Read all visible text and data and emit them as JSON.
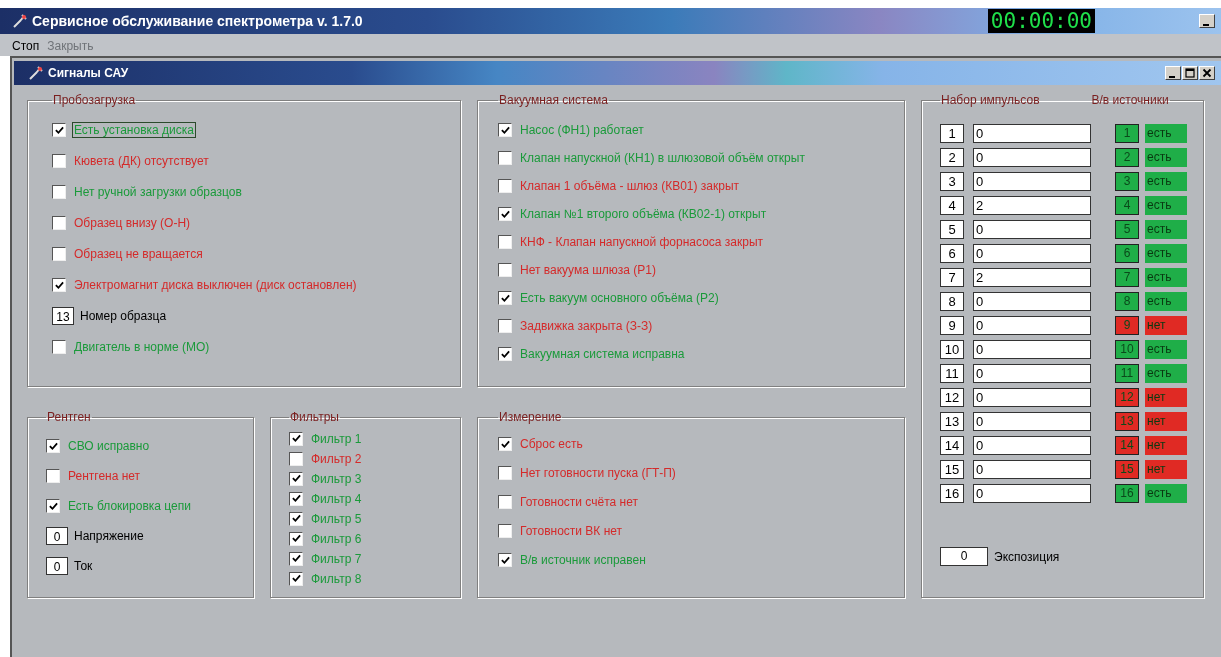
{
  "window": {
    "title": "Сервисное обслуживание спектрометра v. 1.7.0",
    "timer": "00:00:00"
  },
  "menu": [
    {
      "label": "Стоп",
      "disabled": false
    },
    {
      "label": "Закрыть",
      "disabled": true
    }
  ],
  "child_window": {
    "title": "Сигналы САУ"
  },
  "groups": [
    {
      "title": "Пробозагрузка",
      "items": [
        {
          "kind": "checkbox",
          "label": "Есть установка диска",
          "checked": true,
          "color": "#1a9a3a",
          "focused": true
        },
        {
          "kind": "checkbox",
          "label": "Кювета (ДК) отсутствует",
          "checked": false,
          "color": "#d42a2a",
          "focused": false
        },
        {
          "kind": "checkbox",
          "label": "Нет ручной загрузки образцов",
          "checked": false,
          "color": "#1a9a3a",
          "focused": false
        },
        {
          "kind": "checkbox",
          "label": "Образец внизу (О-Н)",
          "checked": false,
          "color": "#d42a2a",
          "focused": false
        },
        {
          "kind": "checkbox",
          "label": "Образец не вращается",
          "checked": false,
          "color": "#d42a2a",
          "focused": false
        },
        {
          "kind": "checkbox",
          "label": "Электромагнит диска выключен (диск остановлен)",
          "checked": true,
          "color": "#d42a2a",
          "focused": false
        },
        {
          "kind": "number",
          "value": "13",
          "label": "Номер образца"
        },
        {
          "kind": "checkbox",
          "label": "Двигатель в норме (МО)",
          "checked": false,
          "color": "#1a9a3a",
          "focused": false
        }
      ]
    },
    {
      "title": "Вакуумная система",
      "items": [
        {
          "kind": "checkbox",
          "label": "Насос (ФН1) работает",
          "checked": true,
          "color": "#1a9a3a"
        },
        {
          "kind": "checkbox",
          "label": "Клапан напускной (КН1) в шлюзовой объём открыт",
          "checked": false,
          "color": "#1a9a3a"
        },
        {
          "kind": "checkbox",
          "label": "Клапан 1 объёма - шлюз (КВ01) закрыт",
          "checked": false,
          "color": "#d42a2a"
        },
        {
          "kind": "checkbox",
          "label": "Клапан №1 второго объёма (КВ02-1) открыт",
          "checked": true,
          "color": "#1a9a3a"
        },
        {
          "kind": "checkbox",
          "label": "КНФ - Клапан напускной форнасоса закрыт",
          "checked": false,
          "color": "#d42a2a"
        },
        {
          "kind": "checkbox",
          "label": "Нет вакуума шлюза (Р1)",
          "checked": false,
          "color": "#d42a2a"
        },
        {
          "kind": "checkbox",
          "label": "Есть вакуум основного объёма (Р2)",
          "checked": true,
          "color": "#1a9a3a"
        },
        {
          "kind": "checkbox",
          "label": "Задвижка закрыта (З-З)",
          "checked": false,
          "color": "#d42a2a"
        },
        {
          "kind": "checkbox",
          "label": "Вакуумная система исправна",
          "checked": true,
          "color": "#1a9a3a"
        }
      ]
    },
    {
      "title": "Рентген",
      "items": [
        {
          "kind": "checkbox",
          "label": "СВО исправно",
          "checked": true,
          "color": "#1a9a3a"
        },
        {
          "kind": "checkbox",
          "label": "Рентгена нет",
          "checked": false,
          "color": "#d42a2a"
        },
        {
          "kind": "checkbox",
          "label": "Есть блокировка цепи",
          "checked": true,
          "color": "#1a9a3a"
        },
        {
          "kind": "number",
          "value": "0",
          "label": "Напряжение"
        },
        {
          "kind": "number",
          "value": "0",
          "label": "Ток"
        }
      ]
    },
    {
      "title": "Фильтры",
      "items": [
        {
          "kind": "checkbox",
          "label": "Фильтр 1",
          "checked": true,
          "color": "#1a9a3a"
        },
        {
          "kind": "checkbox",
          "label": "Фильтр 2",
          "checked": false,
          "color": "#d42a2a"
        },
        {
          "kind": "checkbox",
          "label": "Фильтр 3",
          "checked": true,
          "color": "#1a9a3a"
        },
        {
          "kind": "checkbox",
          "label": "Фильтр 4",
          "checked": true,
          "color": "#1a9a3a"
        },
        {
          "kind": "checkbox",
          "label": "Фильтр 5",
          "checked": true,
          "color": "#1a9a3a"
        },
        {
          "kind": "checkbox",
          "label": "Фильтр 6",
          "checked": true,
          "color": "#1a9a3a"
        },
        {
          "kind": "checkbox",
          "label": "Фильтр 7",
          "checked": true,
          "color": "#1a9a3a"
        },
        {
          "kind": "checkbox",
          "label": "Фильтр 8",
          "checked": true,
          "color": "#1a9a3a"
        }
      ]
    },
    {
      "title": "Измерение",
      "items": [
        {
          "kind": "checkbox",
          "label": "Сброс есть",
          "checked": true,
          "color": "#d42a2a"
        },
        {
          "kind": "checkbox",
          "label": "Нет готовности пуска (ГТ-П)",
          "checked": false,
          "color": "#d42a2a"
        },
        {
          "kind": "checkbox",
          "label": "Готовности счёта нет",
          "checked": false,
          "color": "#d42a2a"
        },
        {
          "kind": "checkbox",
          "label": "Готовности ВК нет",
          "checked": false,
          "color": "#d42a2a"
        },
        {
          "kind": "checkbox",
          "label": "В/в источник исправен",
          "checked": true,
          "color": "#1a9a3a"
        }
      ]
    }
  ],
  "pulses": {
    "title": "Набор импульсов",
    "sources_title": "В/в источники",
    "rows": [
      {
        "number": "1",
        "value": "0",
        "source": "1",
        "status": "есть",
        "color": "#1fae48"
      },
      {
        "number": "2",
        "value": "0",
        "source": "2",
        "status": "есть",
        "color": "#1fae48"
      },
      {
        "number": "3",
        "value": "0",
        "source": "3",
        "status": "есть",
        "color": "#1fae48"
      },
      {
        "number": "4",
        "value": "2",
        "source": "4",
        "status": "есть",
        "color": "#1fae48"
      },
      {
        "number": "5",
        "value": "0",
        "source": "5",
        "status": "есть",
        "color": "#1fae48"
      },
      {
        "number": "6",
        "value": "0",
        "source": "6",
        "status": "есть",
        "color": "#1fae48"
      },
      {
        "number": "7",
        "value": "2",
        "source": "7",
        "status": "есть",
        "color": "#1fae48"
      },
      {
        "number": "8",
        "value": "0",
        "source": "8",
        "status": "есть",
        "color": "#1fae48"
      },
      {
        "number": "9",
        "value": "0",
        "source": "9",
        "status": "нет",
        "color": "#e02a24"
      },
      {
        "number": "10",
        "value": "0",
        "source": "10",
        "status": "есть",
        "color": "#1fae48"
      },
      {
        "number": "11",
        "value": "0",
        "source": "11",
        "status": "есть",
        "color": "#1fae48"
      },
      {
        "number": "12",
        "value": "0",
        "source": "12",
        "status": "нет",
        "color": "#e02a24"
      },
      {
        "number": "13",
        "value": "0",
        "source": "13",
        "status": "нет",
        "color": "#e02a24"
      },
      {
        "number": "14",
        "value": "0",
        "source": "14",
        "status": "нет",
        "color": "#e02a24"
      },
      {
        "number": "15",
        "value": "0",
        "source": "15",
        "status": "нет",
        "color": "#e02a24"
      },
      {
        "number": "16",
        "value": "0",
        "source": "16",
        "status": "есть",
        "color": "#1fae48"
      }
    ],
    "exposure": {
      "value": "0",
      "label": "Экспозиция"
    }
  }
}
